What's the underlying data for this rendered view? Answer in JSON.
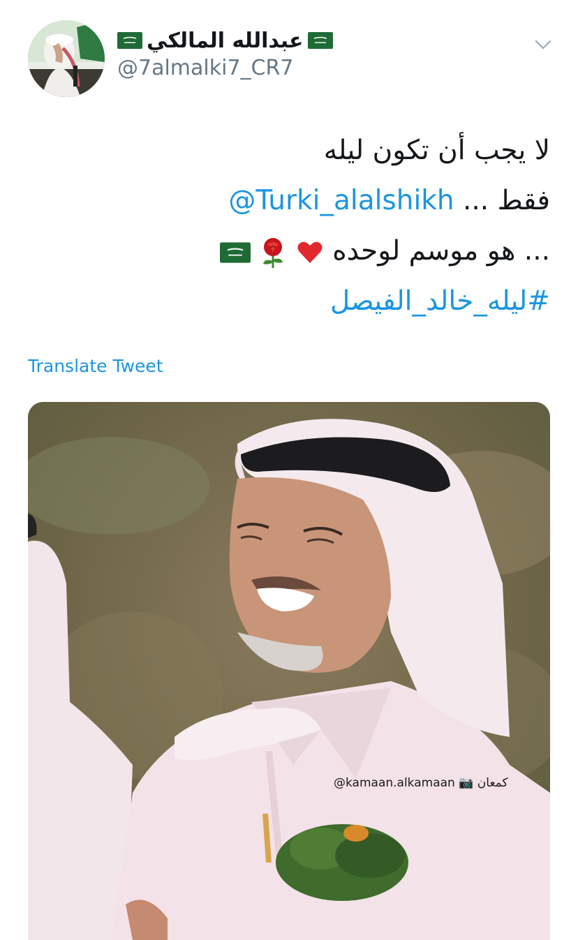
{
  "tweet": {
    "author_name": "عبدالله المالكي",
    "author_handle": "@7almalki7_CR7",
    "lines": [
      {
        "text": "لا يجب أن تكون ليله"
      },
      {
        "prefix": "فقط ...",
        "mention": "@Turki_alalshikh"
      },
      {
        "text": "... هو موسم لوحده"
      },
      {
        "hashtag": "#ليله_خالد_الفيصل"
      }
    ],
    "translate_label": "Translate Tweet"
  },
  "media": {
    "watermark": "@kamaan.alkamaan 📷 كمعان"
  },
  "colors": {
    "link": "#1b95e0",
    "secondary_text": "#657786",
    "flag_green": "#1f6b35"
  },
  "icons": [
    "chevron-down-icon",
    "saudi-flag-icon",
    "heart-icon",
    "rose-icon"
  ]
}
